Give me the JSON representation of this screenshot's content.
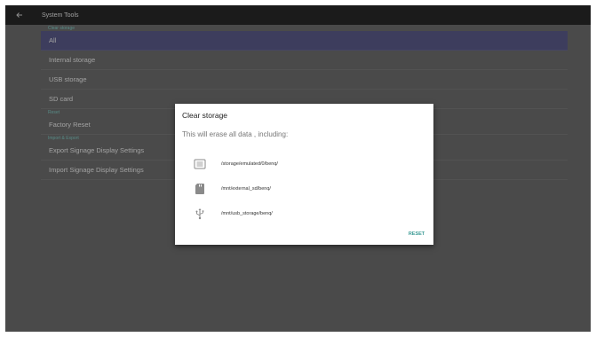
{
  "appbar": {
    "title": "System Tools"
  },
  "list": {
    "clear_storage_header": "Clear storage",
    "items": [
      {
        "label": "All"
      },
      {
        "label": "Internal storage"
      },
      {
        "label": "USB storage"
      },
      {
        "label": "SD card"
      }
    ],
    "reset_header": "Reset",
    "factory_reset": "Factory Reset",
    "import_export_header": "Import & Export",
    "export_label": "Export Signage Display Settings",
    "import_label": "Import Signage Display Settings"
  },
  "dialog": {
    "title": "Clear storage",
    "message": "This will erase all data , including:",
    "paths": [
      {
        "icon": "internal-storage-icon",
        "path": "/storage/emulated/0/benq/"
      },
      {
        "icon": "sd-card-icon",
        "path": "/mnt/external_sd/benq/"
      },
      {
        "icon": "usb-icon",
        "path": "/mnt/usb_storage/benq/"
      }
    ],
    "reset_label": "RESET"
  },
  "colors": {
    "appbar": "#282828",
    "background": "#6e6e6e",
    "selected_row": "#5a5a8a",
    "section_header": "#80cbc4",
    "accent": "#3e9c96"
  }
}
